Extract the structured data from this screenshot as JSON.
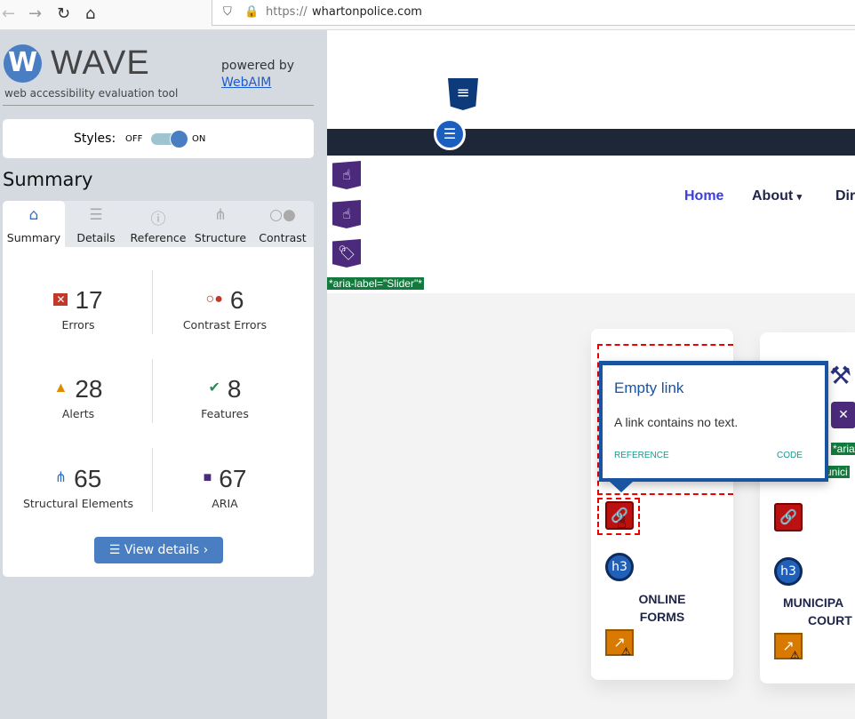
{
  "browser": {
    "url_prefix": "https://",
    "url_domain": "whartonpolice.com"
  },
  "wave": {
    "logo_letter": "W",
    "title": "WAVE",
    "tagline": "web accessibility evaluation tool",
    "powered_by": "powered by",
    "webaim_link": "WebAIM",
    "styles_label": "Styles:",
    "off": "OFF",
    "on": "ON",
    "styles_on": true,
    "summary_heading": "Summary",
    "tabs": [
      {
        "label": "Summary",
        "icon": "home-icon"
      },
      {
        "label": "Details",
        "icon": "list-icon"
      },
      {
        "label": "Reference",
        "icon": "info-icon"
      },
      {
        "label": "Structure",
        "icon": "hierarchy-icon"
      },
      {
        "label": "Contrast",
        "icon": "contrast-icon"
      }
    ],
    "stats": [
      {
        "count": "17",
        "label": "Errors",
        "color": "#c0392b"
      },
      {
        "count": "6",
        "label": "Contrast Errors",
        "color": "#c0392b"
      },
      {
        "count": "28",
        "label": "Alerts",
        "color": "#e08a00"
      },
      {
        "count": "8",
        "label": "Features",
        "color": "#2e8b57"
      },
      {
        "count": "65",
        "label": "Structural Elements",
        "color": "#2e6fc4"
      },
      {
        "count": "67",
        "label": "ARIA",
        "color": "#4b2a7b"
      }
    ],
    "view_details": "View details ›"
  },
  "page": {
    "nav": [
      "Home",
      "About",
      "Dir"
    ],
    "aria_label": "*aria-label=\"Slider\"*",
    "aria_fragment": "*aria",
    "aria_fragment2": "unici",
    "cards": [
      {
        "title_line1": "ONLINE",
        "title_line2": "FORMS"
      },
      {
        "title_line1": "MUNICIPA",
        "title_line2": "COURT"
      }
    ],
    "h3": "h3"
  },
  "tooltip": {
    "title": "Empty link",
    "description": "A link contains no text.",
    "reference": "REFERENCE",
    "code": "CODE"
  }
}
